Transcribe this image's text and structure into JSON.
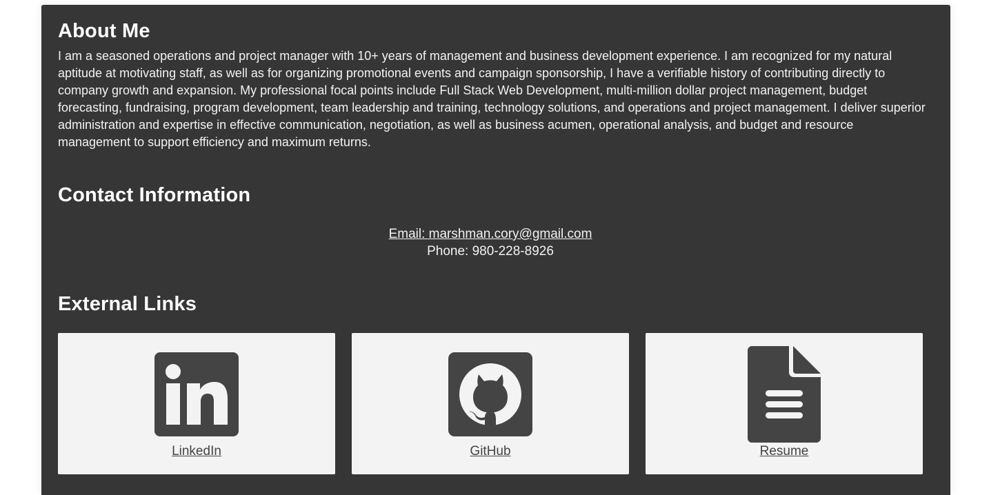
{
  "about": {
    "title": "About Me",
    "text": "I am a seasoned operations and project manager with 10+ years of management and business development experience. I am recognized for my natural aptitude at motivating staff, as well as for organizing promotional events and campaign sponsorship, I have a verifiable history of contributing directly to company growth and expansion. My professional focal points include Full Stack Web Development, multi-million dollar project management, budget forecasting, fundraising, program development, team leadership and training, technology solutions, and operations and project management. I deliver superior administration and expertise in effective communication, negotiation, as well as business acumen, operational analysis, and budget and resource management to support efficiency and maximum returns."
  },
  "contact": {
    "title": "Contact Information",
    "email_text": "Email: marshman.cory@gmail.com",
    "phone_text": "Phone: 980-228-8926"
  },
  "links": {
    "title": "External Links",
    "items": [
      {
        "label": "LinkedIn",
        "icon": "linkedin-icon"
      },
      {
        "label": "GitHub",
        "icon": "github-icon"
      },
      {
        "label": "Resume",
        "icon": "document-icon"
      }
    ]
  },
  "colors": {
    "panel_bg": "#363636",
    "card_bg": "#f3f3f3",
    "icon_dark": "#444444",
    "text_light": "#ffffff"
  }
}
